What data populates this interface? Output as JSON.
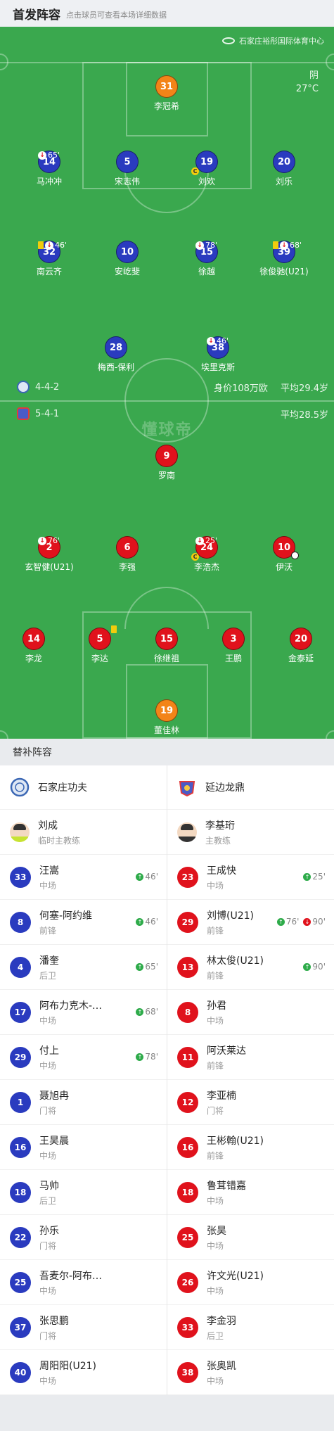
{
  "header": {
    "title": "首发阵容",
    "subtitle": "点击球员可查看本场详细数据"
  },
  "venue": {
    "name": "石家庄裕彤国际体育中心",
    "weather": "阴",
    "temp": "27°C"
  },
  "home": {
    "formation": "4-4-2",
    "value": "身价108万欧",
    "avg_age": "平均29.4岁",
    "players": [
      {
        "num": "31",
        "name": "李冠希",
        "color": "orange"
      },
      {
        "num": "14",
        "name": "马冲冲",
        "color": "blue",
        "sub": "65'"
      },
      {
        "num": "5",
        "name": "宋志伟",
        "color": "blue"
      },
      {
        "num": "19",
        "name": "刘欢",
        "color": "blue",
        "captain": "C"
      },
      {
        "num": "20",
        "name": "刘乐",
        "color": "blue"
      },
      {
        "num": "32",
        "name": "南云齐",
        "color": "blue",
        "sub": "46'",
        "yellow": true
      },
      {
        "num": "10",
        "name": "安屹斐",
        "color": "blue"
      },
      {
        "num": "15",
        "name": "徐越",
        "color": "blue",
        "sub": "78'"
      },
      {
        "num": "39",
        "name": "徐俊驰(U21)",
        "color": "blue",
        "sub": "68'",
        "yellow": true
      },
      {
        "num": "28",
        "name": "梅西-保利",
        "color": "blue"
      },
      {
        "num": "38",
        "name": "埃里克斯",
        "color": "blue",
        "sub": "46'"
      }
    ]
  },
  "away": {
    "formation": "5-4-1",
    "avg_age": "平均28.5岁",
    "players": [
      {
        "num": "9",
        "name": "罗南",
        "color": "red"
      },
      {
        "num": "2",
        "name": "玄智健(U21)",
        "color": "red",
        "sub": "76'"
      },
      {
        "num": "6",
        "name": "李强",
        "color": "red"
      },
      {
        "num": "24",
        "name": "李浩杰",
        "color": "red",
        "sub": "25'",
        "captain": "C"
      },
      {
        "num": "10",
        "name": "伊沃",
        "color": "red",
        "goal": true
      },
      {
        "num": "14",
        "name": "李龙",
        "color": "red"
      },
      {
        "num": "5",
        "name": "李达",
        "color": "red",
        "yellow": true
      },
      {
        "num": "15",
        "name": "徐继祖",
        "color": "red"
      },
      {
        "num": "3",
        "name": "王鹏",
        "color": "red"
      },
      {
        "num": "20",
        "name": "金泰延",
        "color": "red"
      },
      {
        "num": "19",
        "name": "董佳林",
        "color": "orange"
      }
    ]
  },
  "watermark": "懂球帝",
  "subs": {
    "title": "替补阵容",
    "left": {
      "team": "石家庄功夫",
      "coach": {
        "name": "刘成",
        "role": "临时主教练"
      },
      "players": [
        {
          "num": "33",
          "name": "汪嵩",
          "pos": "中场",
          "in": "46'"
        },
        {
          "num": "8",
          "name": "何塞-阿约维",
          "pos": "前锋",
          "in": "46'"
        },
        {
          "num": "4",
          "name": "潘奎",
          "pos": "后卫",
          "in": "65'"
        },
        {
          "num": "17",
          "name": "阿布力克木-…",
          "pos": "中场",
          "in": "68'"
        },
        {
          "num": "29",
          "name": "付上",
          "pos": "中场",
          "in": "78'"
        },
        {
          "num": "1",
          "name": "聂旭冉",
          "pos": "门将"
        },
        {
          "num": "16",
          "name": "王昊晨",
          "pos": "中场"
        },
        {
          "num": "18",
          "name": "马帅",
          "pos": "后卫"
        },
        {
          "num": "22",
          "name": "孙乐",
          "pos": "门将"
        },
        {
          "num": "25",
          "name": "吾麦尔-阿布…",
          "pos": "中场"
        },
        {
          "num": "37",
          "name": "张思鹏",
          "pos": "门将"
        },
        {
          "num": "40",
          "name": "周阳阳(U21)",
          "pos": "中场"
        }
      ]
    },
    "right": {
      "team": "延边龙鼎",
      "coach": {
        "name": "李基珩",
        "role": "主教练"
      },
      "players": [
        {
          "num": "23",
          "name": "王成快",
          "pos": "中场",
          "in": "25'"
        },
        {
          "num": "29",
          "name": "刘博(U21)",
          "pos": "前锋",
          "in": "76'",
          "out": "90'"
        },
        {
          "num": "13",
          "name": "林太俊(U21)",
          "pos": "前锋",
          "in": "90'"
        },
        {
          "num": "8",
          "name": "孙君",
          "pos": "中场"
        },
        {
          "num": "11",
          "name": "阿沃莱达",
          "pos": "前锋"
        },
        {
          "num": "12",
          "name": "李亚楠",
          "pos": "门将"
        },
        {
          "num": "16",
          "name": "王彬翰(U21)",
          "pos": "前锋"
        },
        {
          "num": "18",
          "name": "鲁茸错嘉",
          "pos": "中场"
        },
        {
          "num": "25",
          "name": "张昊",
          "pos": "中场"
        },
        {
          "num": "26",
          "name": "许文光(U21)",
          "pos": "中场"
        },
        {
          "num": "33",
          "name": "李金羽",
          "pos": "后卫"
        },
        {
          "num": "38",
          "name": "张奥凯",
          "pos": "中场"
        }
      ]
    }
  }
}
